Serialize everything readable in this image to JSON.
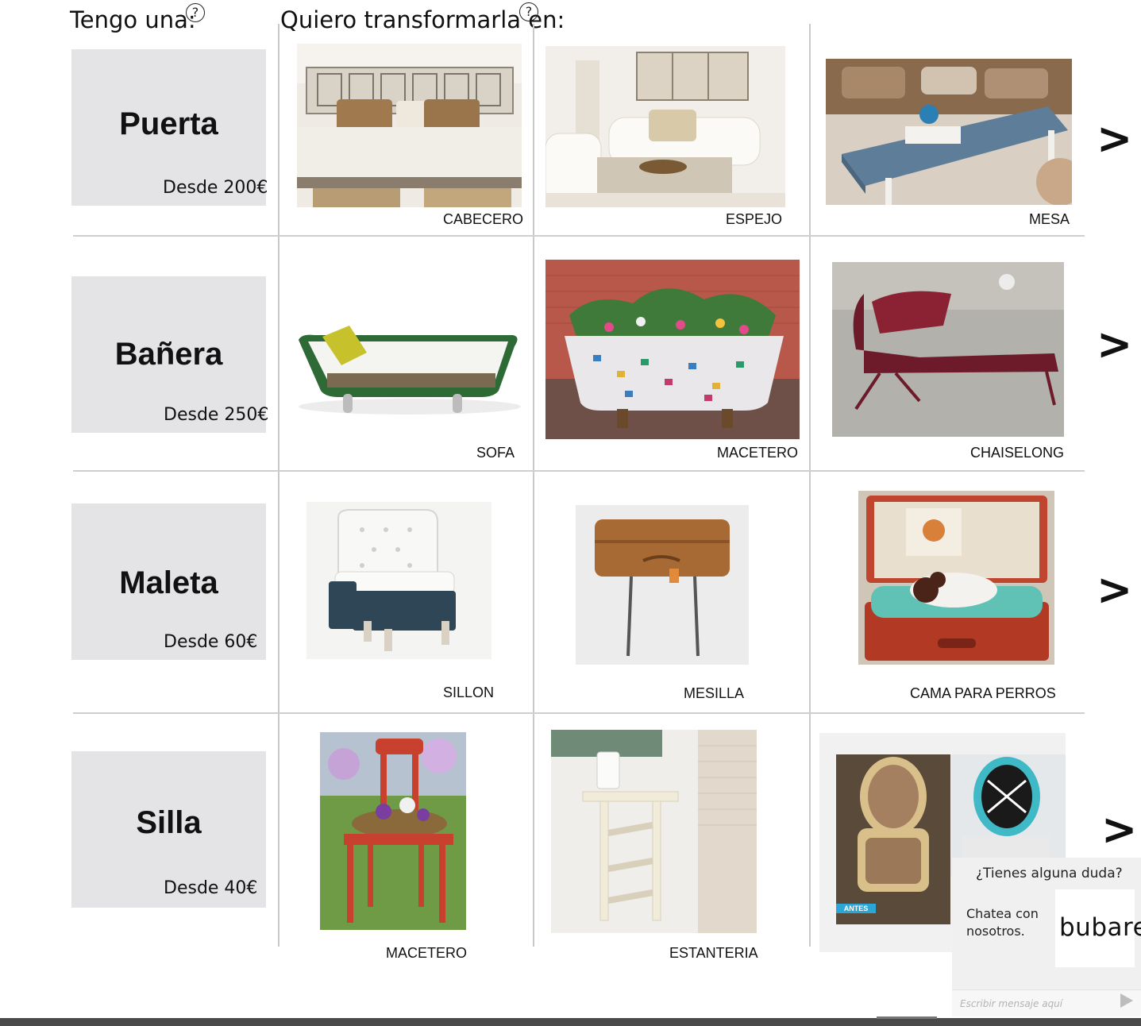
{
  "header": {
    "have_label": "Tengo una:",
    "want_label": "Quiero transformarla en:",
    "help_glyph": "?"
  },
  "rows": [
    {
      "source": {
        "name": "Puerta",
        "price": "Desde 200€"
      },
      "options": [
        {
          "label": "CABECERO",
          "icon": "headboard-bed-photo"
        },
        {
          "label": "ESPEJO",
          "icon": "mirror-living-room-photo"
        },
        {
          "label": "MESA",
          "icon": "coffee-table-photo"
        }
      ]
    },
    {
      "source": {
        "name": "Bañera",
        "price": "Desde 250€"
      },
      "options": [
        {
          "label": "SOFA",
          "icon": "bathtub-sofa-photo"
        },
        {
          "label": "MACETERO",
          "icon": "mosaic-bathtub-planter-photo"
        },
        {
          "label": "CHAISELONG",
          "icon": "chaise-longue-photo"
        }
      ]
    },
    {
      "source": {
        "name": "Maleta",
        "price": "Desde 60€"
      },
      "options": [
        {
          "label": "SILLON",
          "icon": "suitcase-armchair-photo"
        },
        {
          "label": "MESILLA",
          "icon": "suitcase-side-table-photo"
        },
        {
          "label": "CAMA PARA PERROS",
          "icon": "suitcase-dog-bed-photo"
        }
      ]
    },
    {
      "source": {
        "name": "Silla",
        "price": "Desde 40€"
      },
      "options": [
        {
          "label": "MACETERO",
          "icon": "chair-planter-photo"
        },
        {
          "label": "ESTANTERIA",
          "icon": "chair-shelf-photo"
        },
        {
          "label": "",
          "icon": "reupholstered-chairs-photo",
          "badge": "ANTES"
        }
      ]
    }
  ],
  "next_arrow": ">",
  "chat": {
    "question": "¿Tienes alguna duda?",
    "subtitle": "Chatea con nosotros.",
    "logo": "bubare",
    "input_placeholder": "Escribir mensaje aquí"
  },
  "colors": {
    "card_bg": "#e4e4e6",
    "divider": "#c9c9c9",
    "chat_bg": "#f0f0f0",
    "badge_bg": "#2aa6d8"
  }
}
